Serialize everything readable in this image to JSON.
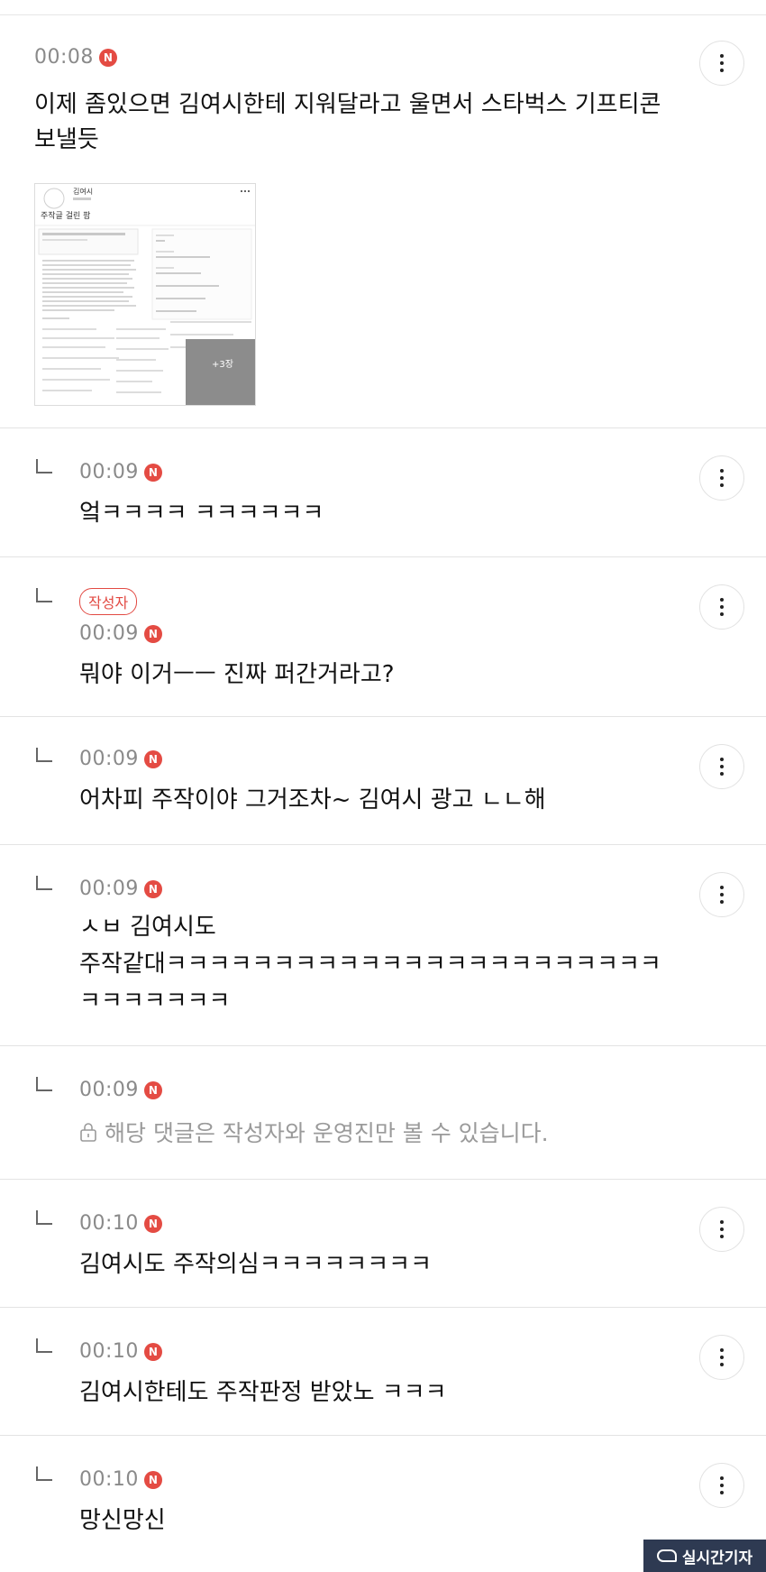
{
  "badge_letter": "N",
  "author_label": "작성자",
  "main_comment": {
    "time": "00:08",
    "text_line1": "이제 좀있으면 김여시한테 지워달라고 울면서 스타벅스 기프티콘",
    "text_line2": "보낼듯",
    "thumbnail": {
      "profile_name": "김여시",
      "post_title": "주작글 걸린 팜",
      "photo_count": "+3장"
    }
  },
  "replies": [
    {
      "time": "00:09",
      "text": "엌ㅋㅋㅋㅋ ㅋㅋㅋㅋㅋㅋ"
    },
    {
      "time": "00:09",
      "author": true,
      "text": "뭐야 이거ㅡㅡ 진짜 퍼간거라고?"
    },
    {
      "time": "00:09",
      "text": "어차피 주작이야 그거조차~ 김여시 광고 ㄴㄴ해"
    },
    {
      "time": "00:09",
      "lines": [
        "ㅅㅂ 김여시도",
        "주작같대ㅋㅋㅋㅋㅋㅋㅋㅋㅋㅋㅋㅋㅋㅋㅋㅋㅋㅋㅋㅋㅋㅋㅋ",
        "ㅋㅋㅋㅋㅋㅋㅋ"
      ]
    },
    {
      "time": "00:09",
      "private_text": "해당 댓글은 작성자와 운영진만 볼 수 있습니다."
    },
    {
      "time": "00:10",
      "text": "김여시도 주작의심ㅋㅋㅋㅋㅋㅋㅋㅋ"
    },
    {
      "time": "00:10",
      "text": "김여시한테도 주작판정 받았노 ㅋㅋㅋ"
    },
    {
      "time": "00:10",
      "text": "망신망신"
    }
  ],
  "watermark": {
    "text": "실시간기자"
  },
  "icons": {
    "more": "more-vertical-icon",
    "reply": "reply-arrow-icon",
    "lock": "lock-icon",
    "badge": "new-badge-icon"
  },
  "colors": {
    "badge": "#e44b43",
    "author": "#e24a43",
    "time": "#8a8a8a",
    "muted": "#9a9a9a"
  }
}
